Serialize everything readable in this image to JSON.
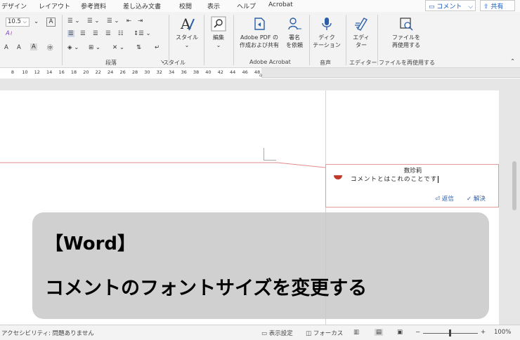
{
  "tabs": [
    "デザイン",
    "レイアウト",
    "参考資料",
    "差し込み文書",
    "校閲",
    "表示",
    "ヘルプ",
    "Acrobat"
  ],
  "header_buttons": {
    "comment": "コメント",
    "share": "共有"
  },
  "ribbon": {
    "font_size": "10.5",
    "font_buttons": {
      "grow": "A",
      "shrink": "A",
      "clear": "A",
      "phonetic": "㊥",
      "boxed": "A",
      "highlight_pen": "A"
    },
    "group_labels": {
      "paragraph": "段落",
      "style": "スタイル",
      "adobe": "Adobe Acrobat",
      "voice": "音声",
      "editor": "エディター",
      "reuse": "ファイルを再使用する"
    },
    "style_button": "スタイル",
    "edit_button": "編集",
    "adobe_pdf_share": [
      "Adobe PDF の",
      "作成および共有"
    ],
    "sign_request": [
      "署名",
      "を依頼"
    ],
    "dictate": [
      "ディク",
      "テーション"
    ],
    "editor": [
      "エディ",
      "ター"
    ],
    "reuse_file": [
      "ファイルを",
      "再使用する"
    ]
  },
  "ruler_ticks": [
    "8",
    "10",
    "12",
    "14",
    "16",
    "18",
    "20",
    "22",
    "24",
    "26",
    "28",
    "30",
    "32",
    "34",
    "36",
    "38",
    "40",
    "42",
    "44",
    "46",
    "48"
  ],
  "comment": {
    "author": "数珍莉",
    "text": "コメントとはこれのことです",
    "reply": "返信",
    "resolve": "解決"
  },
  "overlay": {
    "title": "【Word】",
    "subtitle": "コメントのフォントサイズを変更する"
  },
  "status": {
    "accessibility": "アクセシビリティ: 問題ありません",
    "display_settings": "表示設定",
    "focus": "フォーカス",
    "zoom": "100%",
    "zoom_minus": "−",
    "zoom_plus": "+"
  },
  "colors": {
    "accent": "#185abd",
    "comment_border": "#e49a9a",
    "avatar": "#c0392b",
    "overlay": "#c8c8c8"
  }
}
